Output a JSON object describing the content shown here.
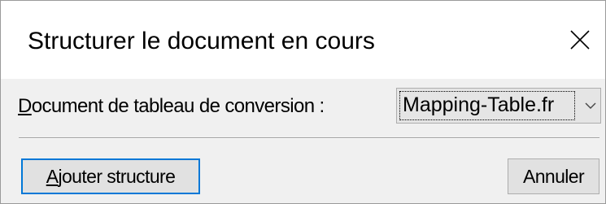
{
  "dialog": {
    "title": "Structurer le document en cours",
    "close_icon": "close-icon"
  },
  "mapping": {
    "label_mnemonic": "D",
    "label_rest": "ocument de tableau de conversion :",
    "selected_value": "Mapping-Table.fr",
    "arrow_icon": "chevron-down-icon"
  },
  "buttons": {
    "add_mnemonic": "A",
    "add_rest": "jouter structure",
    "cancel_label": "Annuler"
  }
}
